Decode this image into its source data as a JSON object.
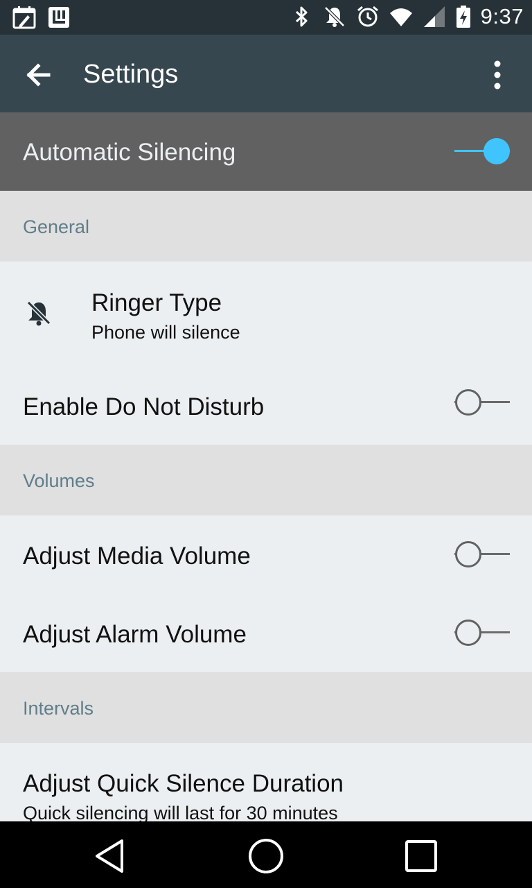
{
  "status_bar": {
    "left_icons": [
      "calendar-edit-icon",
      "launcher-icon"
    ],
    "right_icons": [
      "bluetooth-icon",
      "notifications-off-icon",
      "alarm-icon",
      "wifi-icon",
      "signal-icon",
      "battery-charging-icon"
    ],
    "time": "9:37"
  },
  "app_bar": {
    "title": "Settings",
    "back_icon": "arrow-back-icon",
    "menu_icon": "more-vert-icon"
  },
  "master_switch": {
    "label": "Automatic Silencing",
    "enabled": true
  },
  "sections": {
    "general": {
      "header": "General",
      "ringer": {
        "icon": "bell-off-icon",
        "title": "Ringer Type",
        "subtitle": "Phone will silence"
      },
      "dnd": {
        "title": "Enable Do Not Disturb",
        "enabled": false
      }
    },
    "volumes": {
      "header": "Volumes",
      "media": {
        "title": "Adjust Media Volume",
        "enabled": false
      },
      "alarm": {
        "title": "Adjust Alarm Volume",
        "enabled": false
      }
    },
    "intervals": {
      "header": "Intervals",
      "quick": {
        "title": "Adjust Quick Silence Duration",
        "subtitle": "Quick silencing will last for 30 minutes"
      }
    }
  },
  "nav_bar": {
    "icons": [
      "back-triangle-icon",
      "home-circle-icon",
      "recents-square-icon"
    ]
  },
  "colors": {
    "status_bar": "#263238",
    "app_bar": "#37474F",
    "master_row": "#616161",
    "section_header": "#E0E0E0",
    "section_header_text": "#607D8B",
    "row_bg": "#ECEFF1",
    "accent": "#40C4FF"
  }
}
